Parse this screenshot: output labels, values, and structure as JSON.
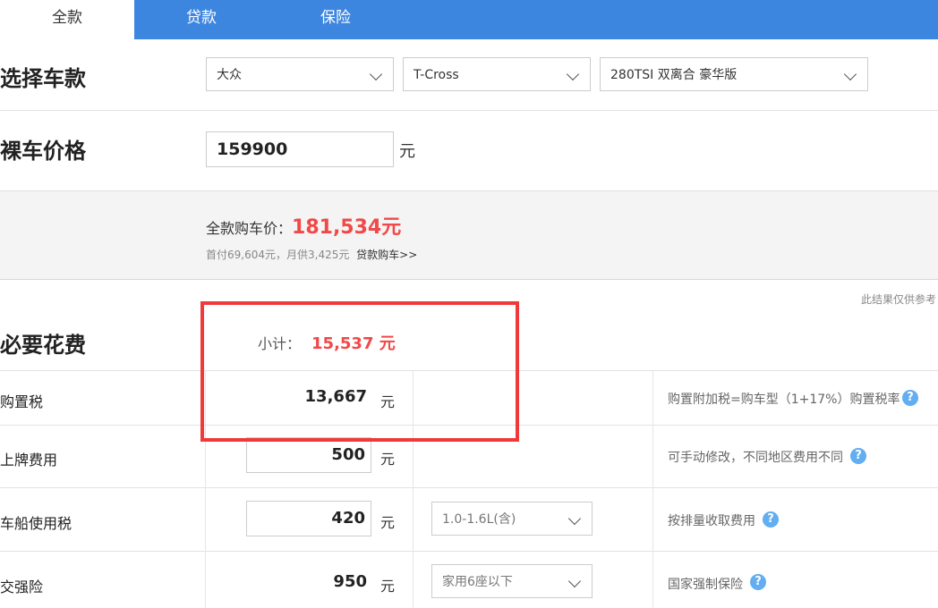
{
  "tabs": [
    "全款",
    "贷款",
    "保险"
  ],
  "select_model": {
    "heading": "选择车款",
    "brand": "大众",
    "series": "T-Cross",
    "trim": "280TSI 双离合 豪华版"
  },
  "bare_price": {
    "heading": "裸车价格",
    "value": "159900",
    "unit": "元"
  },
  "summary": {
    "label": "全款购车价：",
    "total": "181,534元",
    "sub": "首付69,604元，月供3,425元",
    "loan_link": "贷款购车>>"
  },
  "disclaimer": "此结果仅供参考",
  "required": {
    "heading": "必要花费",
    "subtotal_label": "小计：",
    "subtotal_value": "15,537 元",
    "rows": [
      {
        "label": "购置税",
        "value": "13,667",
        "unit": "元",
        "note": "购置附加税=购车型（1+17%）购置税率"
      },
      {
        "label": "上牌费用",
        "value": "500",
        "unit": "元",
        "note": "可手动修改，不同地区费用不同"
      },
      {
        "label": "车船使用税",
        "value": "420",
        "unit": "元",
        "select": "1.0-1.6L(含)",
        "note": "按排量收取费用"
      },
      {
        "label": "交强险",
        "value": "950",
        "unit": "元",
        "select": "家用6座以下",
        "note": "国家强制保险"
      }
    ]
  },
  "icons": {
    "help": "question-icon",
    "dropdown": "chevron-down-icon"
  },
  "colors": {
    "tab_bar": "#3d86e0",
    "accent_red": "#f24848",
    "highlight_box": "#f03a3a",
    "help_icon": "#62aef0"
  }
}
